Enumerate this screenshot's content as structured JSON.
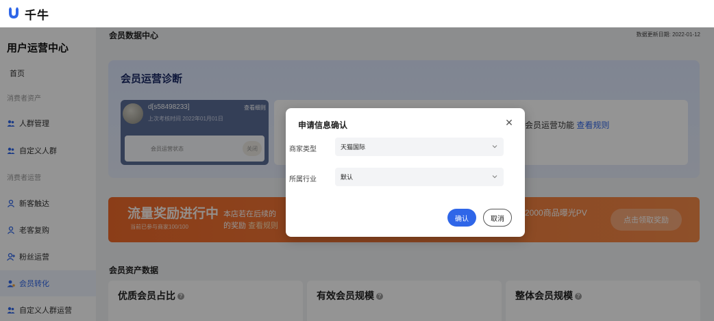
{
  "app": {
    "name": "千牛",
    "logo_icon": "qianniu-logo-icon",
    "brand_color": "#2f66e8"
  },
  "sidebar": {
    "title": "用户运营中心",
    "items": [
      {
        "label": "首页",
        "kind": "plain"
      },
      {
        "label": "消费者资产",
        "kind": "group"
      },
      {
        "label": "人群管理",
        "kind": "link",
        "icon": "people-icon"
      },
      {
        "label": "自定义人群",
        "kind": "link",
        "icon": "people-icon"
      },
      {
        "label": "消费者运营",
        "kind": "group"
      },
      {
        "label": "新客触达",
        "kind": "link",
        "icon": "user-icon"
      },
      {
        "label": "老客复购",
        "kind": "link",
        "icon": "user-icon"
      },
      {
        "label": "粉丝运营",
        "kind": "link",
        "icon": "user-plus-icon"
      },
      {
        "label": "会员转化",
        "kind": "link",
        "icon": "member-icon",
        "active": true
      },
      {
        "label": "自定义人群运营",
        "kind": "link",
        "icon": "people-icon"
      }
    ]
  },
  "main": {
    "page_title": "会员数据中心",
    "update_date": "数据更新日期: 2022-01-12",
    "diagnosis": {
      "title": "会员运营诊断",
      "store_name": "d[s58498233]",
      "store_link": "查看细则",
      "last_check": "上次考核时间 2022年01月01日",
      "status_label": "会员运营状态",
      "status_value": "关闭",
      "info_text": "会员运营功能",
      "info_link": "查看规则"
    },
    "banner": {
      "title": "流量奖励进行中",
      "subtitle": "当前已参与商家100/100",
      "desc_line1": "本店若在后续的",
      "desc_line2": "的奖励",
      "desc_link": "查看规则",
      "right_text": "2000商品曝光PV",
      "button": "点击领取奖励"
    },
    "assets": {
      "title": "会员资产数据",
      "metrics": [
        "优质会员占比",
        "有效会员规模",
        "整体会员规模"
      ]
    }
  },
  "modal": {
    "title": "申请信息确认",
    "close_icon": "close-icon",
    "fields": [
      {
        "label": "商家类型",
        "value": "天猫国际"
      },
      {
        "label": "所属行业",
        "value": "默认"
      }
    ],
    "confirm": "确认",
    "cancel": "取消"
  }
}
